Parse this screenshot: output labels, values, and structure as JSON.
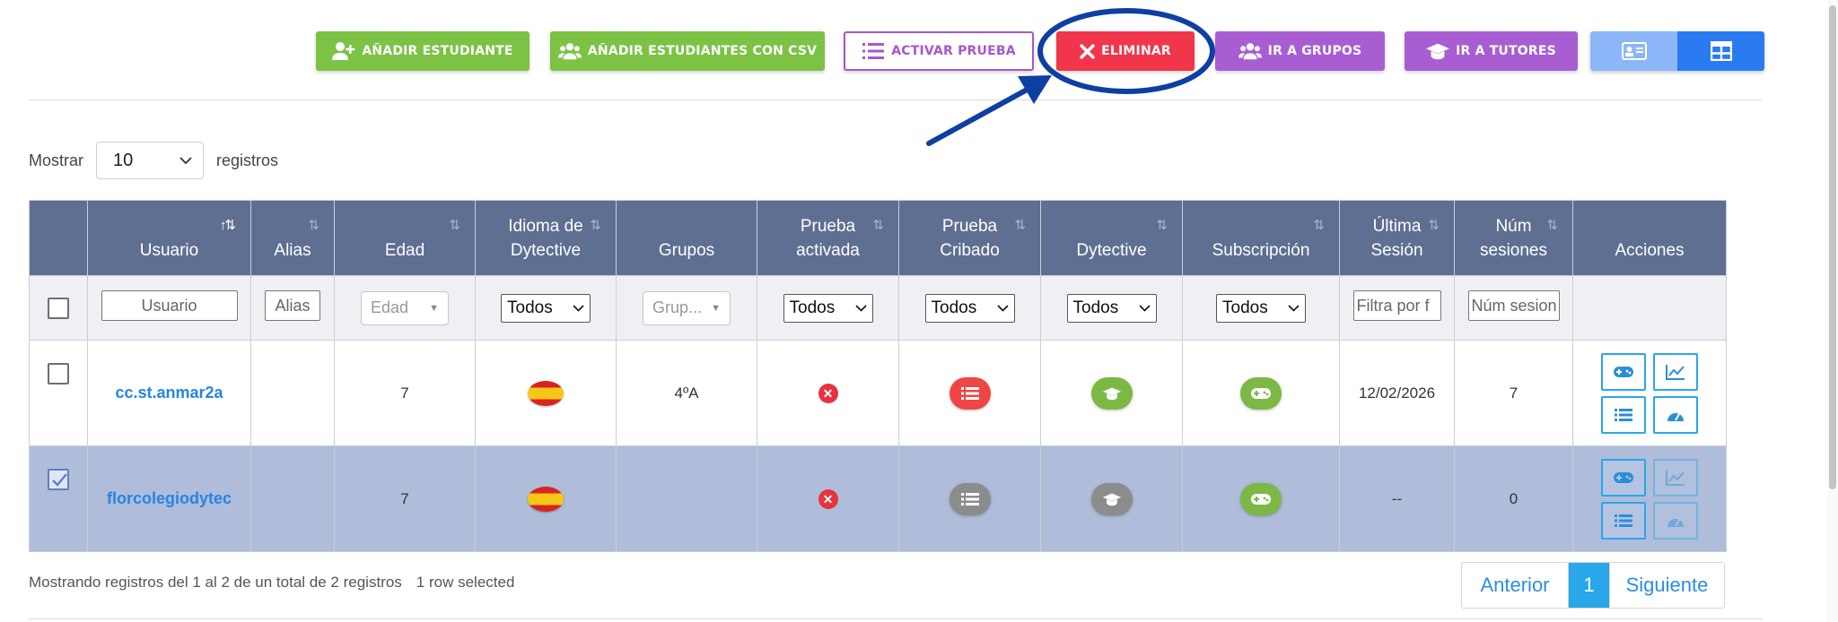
{
  "toolbar": {
    "add_student": "AÑADIR ESTUDIANTE",
    "add_csv": "AÑADIR ESTUDIANTES CON CSV",
    "activate_test": "ACTIVAR PRUEBA",
    "delete": "ELIMINAR",
    "go_groups": "IR A GRUPOS",
    "go_tutors": "IR A TUTORES",
    "colors": {
      "green": "#7cc245",
      "red": "#f1364c",
      "purple": "#a85ed2",
      "blue": "#2a7bf1"
    }
  },
  "show": {
    "prefix": "Mostrar",
    "value": "10",
    "suffix": "registros"
  },
  "table": {
    "headers": {
      "user": "Usuario",
      "alias": "Alias",
      "age": "Edad",
      "lang1": "Idioma de",
      "lang2": "Dytective",
      "groups": "Grupos",
      "test1": "Prueba",
      "test2": "activada",
      "screen1": "Prueba",
      "screen2": "Cribado",
      "dytective": "Dytective",
      "subscription": "Subscripción",
      "last1": "Última",
      "last2": "Sesión",
      "num1": "Núm",
      "num2": "sesiones",
      "actions": "Acciones"
    },
    "filters": {
      "user_placeholder": "Usuario",
      "alias_placeholder": "Alias",
      "age": "Edad",
      "lang": "Todos",
      "groups": "Grup...",
      "test": "Todos",
      "screen": "Todos",
      "dytective": "Todos",
      "subscription": "Todos",
      "last_placeholder": "Filtra por f",
      "num_placeholder": "Núm sesion"
    },
    "rows": [
      {
        "user": "cc.st.anmar2a",
        "alias": "",
        "age": "7",
        "group": "4ºA",
        "last": "12/02/2026",
        "sessions": "7",
        "selected": false
      },
      {
        "user": "florcolegiodytec",
        "alias": "",
        "age": "7",
        "group": "",
        "last": "--",
        "sessions": "0",
        "selected": true
      }
    ]
  },
  "footer": {
    "info": "Mostrando registros del 1 al 2 de un total de 2 registros",
    "selected": "1 row selected"
  },
  "pagination": {
    "prev": "Anterior",
    "current": "1",
    "next": "Siguiente"
  }
}
